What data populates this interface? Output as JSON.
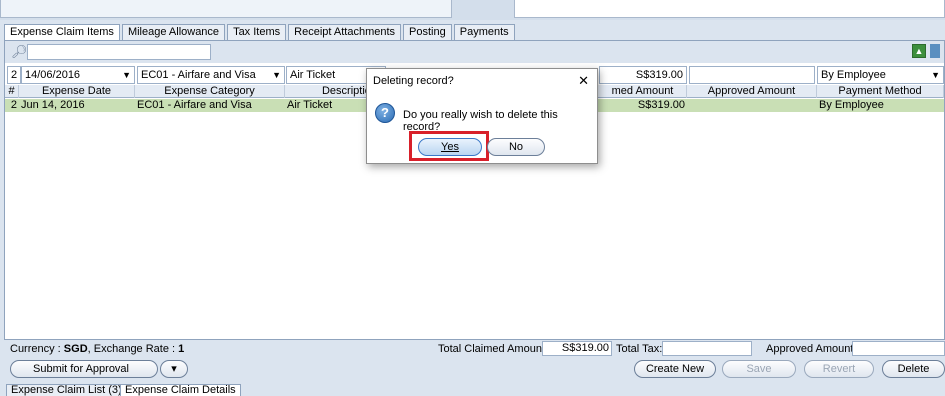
{
  "tabs": [
    "Expense Claim Items",
    "Mileage Allowance",
    "Tax Items",
    "Receipt Attachments",
    "Posting",
    "Payments"
  ],
  "search": {
    "icon": "magnifier-icon",
    "value": ""
  },
  "edit_row": {
    "row_no": "2",
    "expense_date": "14/06/2016",
    "category": "EC01 - Airfare and Visa",
    "description": "Air Ticket",
    "claimed_amount": "S$319.00",
    "approved_amount": "",
    "payment_method": "By Employee"
  },
  "columns": [
    "#",
    "Expense Date",
    "Expense Category",
    "Description",
    "med Amount",
    "Approved Amount",
    "Payment Method"
  ],
  "rows": [
    {
      "no": "2",
      "date": "Jun 14, 2016",
      "category": "EC01 - Airfare and Visa",
      "description": "Air Ticket",
      "claimed": "S$319.00",
      "approved": "",
      "method": "By Employee"
    }
  ],
  "summary": {
    "currency_label": "Currency : ",
    "currency": "SGD",
    "rate_label": ", Exchange Rate : ",
    "rate": "1",
    "total_claimed_label": "Total Claimed Amount:",
    "total_claimed": "S$319.00",
    "total_tax_label": "Total Tax:",
    "approved_label": "Approved Amount:"
  },
  "buttons": {
    "submit": "Submit for Approval",
    "create": "Create New",
    "save": "Save",
    "revert": "Revert",
    "delete": "Delete"
  },
  "bottom_tabs": [
    "Expense Claim List (3)",
    "Expense Claim Details"
  ],
  "dialog": {
    "title": "Deleting record?",
    "close": "✕",
    "icon": "question-icon",
    "message": "Do you really wish to delete this record?",
    "yes": "Yes",
    "no": "No",
    "highlight_color": "#d8202a"
  }
}
